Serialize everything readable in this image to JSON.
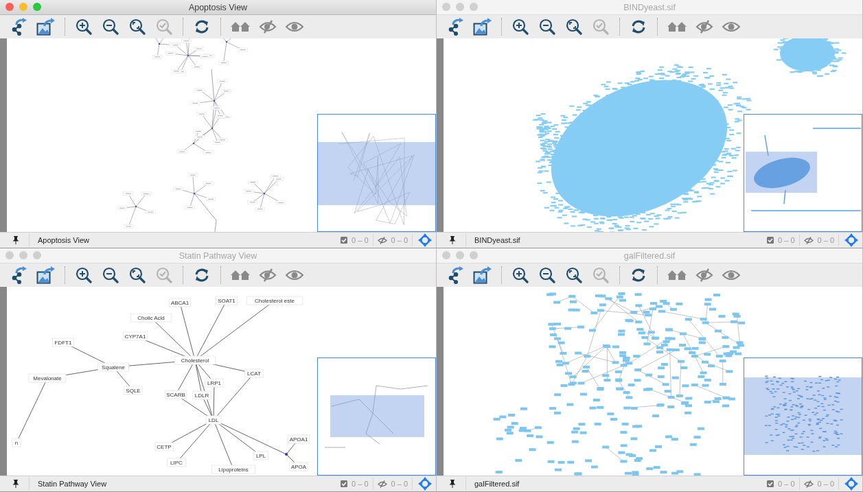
{
  "toolbar": [
    {
      "kind": "share-network",
      "disabled": false
    },
    {
      "kind": "export-image",
      "disabled": false
    },
    {
      "kind": "zoom-in",
      "disabled": false
    },
    {
      "kind": "zoom-out",
      "disabled": false
    },
    {
      "kind": "zoom-fit",
      "disabled": false
    },
    {
      "kind": "zoom-selected",
      "disabled": true
    },
    {
      "kind": "refresh",
      "disabled": false
    },
    {
      "kind": "home",
      "disabled": false
    },
    {
      "kind": "hide",
      "disabled": false
    },
    {
      "kind": "show",
      "disabled": false
    }
  ],
  "windows": [
    {
      "title": "Apoptosis View",
      "active": true,
      "network": {
        "kind": "star-clusters"
      },
      "status": {
        "name": "Apoptosis View",
        "selected": "0 – 0",
        "hidden": "0 – 0"
      }
    },
    {
      "title": "BINDyeast.sif",
      "active": false,
      "network": {
        "kind": "dense-cloud"
      },
      "status": {
        "name": "BINDyeast.sif",
        "selected": "0 – 0",
        "hidden": "0 – 0"
      }
    },
    {
      "title": "Statin Pathway View",
      "active": false,
      "network": {
        "kind": "labeled",
        "nodes": [
          {
            "kind": "box",
            "label": "ABCA1"
          },
          {
            "kind": "box",
            "label": "SOAT1"
          },
          {
            "kind": "box",
            "label": "Cholesterol este"
          },
          {
            "kind": "box",
            "label": "Cholic Acid"
          },
          {
            "kind": "box",
            "label": "CYP7A1"
          },
          {
            "kind": "box",
            "label": "FDFT1"
          },
          {
            "kind": "box",
            "label": "Squalene"
          },
          {
            "kind": "box",
            "label": "Mevalonate"
          },
          {
            "kind": "box",
            "label": "SQLE"
          },
          {
            "kind": "box",
            "label": "Cholesterol"
          },
          {
            "kind": "box",
            "label": "LCAT"
          },
          {
            "kind": "box",
            "label": "LRP1"
          },
          {
            "kind": "box",
            "label": "SCARB"
          },
          {
            "kind": "box",
            "label": "LDLR"
          },
          {
            "kind": "box",
            "label": "LDL"
          },
          {
            "kind": "box",
            "label": "CETP"
          },
          {
            "kind": "box",
            "label": "LIPC"
          },
          {
            "kind": "box",
            "label": "LPL"
          },
          {
            "kind": "box",
            "label": "Lipoproteins"
          },
          {
            "kind": "box",
            "label": "APOA1"
          },
          {
            "kind": "box",
            "label": "APOA"
          },
          {
            "kind": "point"
          },
          {
            "kind": "box",
            "label": "n"
          }
        ]
      },
      "status": {
        "name": "Statin Pathway View",
        "selected": "0 – 0",
        "hidden": "0 – 0"
      }
    },
    {
      "title": "galFiltered.sif",
      "active": false,
      "network": {
        "kind": "scattered-boxes"
      },
      "status": {
        "name": "galFiltered.sif",
        "selected": "0 – 0",
        "hidden": "0 – 0"
      }
    }
  ]
}
